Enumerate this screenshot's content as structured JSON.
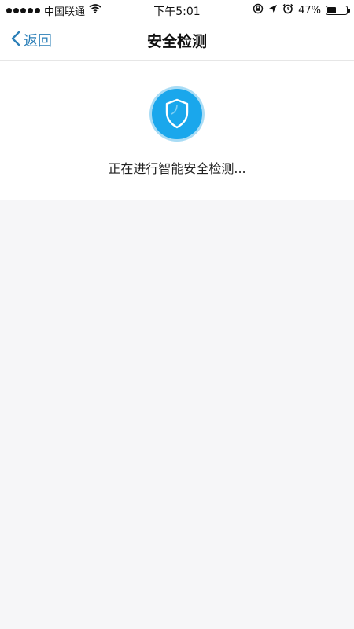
{
  "status_bar": {
    "carrier": "中国联通",
    "time": "下午5:01",
    "battery_percent": "47%",
    "battery_level": 0.47,
    "icons": [
      "wifi-icon",
      "rotation-lock-icon",
      "location-arrow-icon",
      "alarm-icon",
      "battery-icon"
    ]
  },
  "nav": {
    "back_label": "返回",
    "title": "安全检测"
  },
  "detection": {
    "status_text": "正在进行智能安全检测...",
    "icon": "shield-icon",
    "accent_color": "#1aa7ec"
  },
  "colors": {
    "link": "#2c7fb8",
    "background": "#f6f6f8"
  }
}
